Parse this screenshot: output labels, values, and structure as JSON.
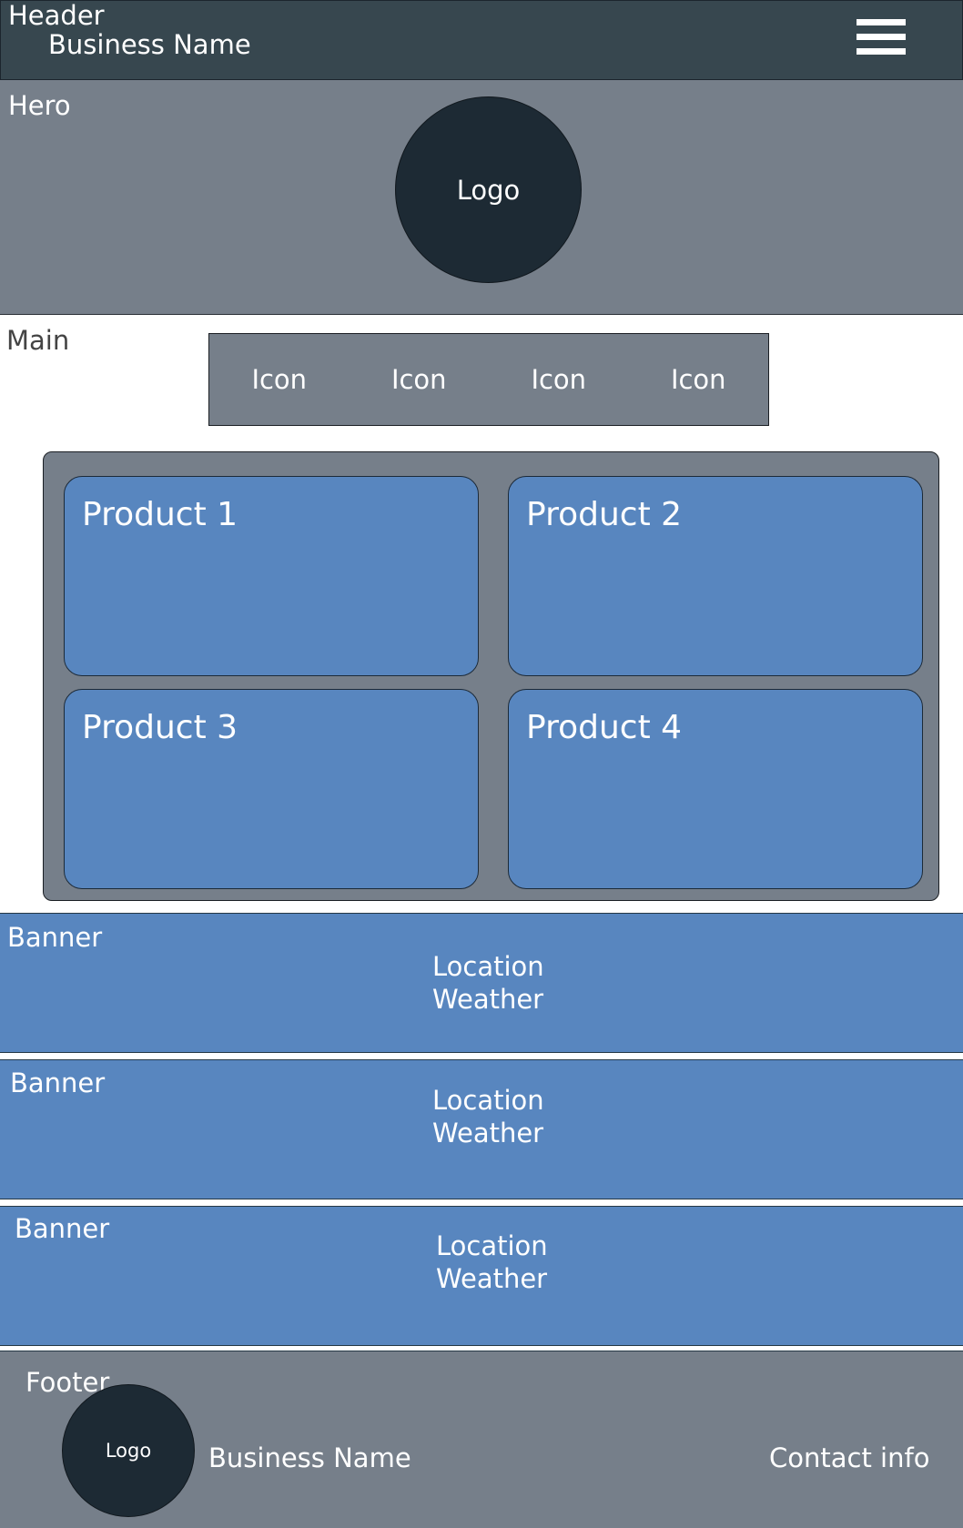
{
  "header": {
    "label": "Header",
    "business_name": "Business Name",
    "menu_icon": "hamburger-menu-icon"
  },
  "hero": {
    "label": "Hero",
    "logo": "Logo"
  },
  "main": {
    "label": "Main",
    "icons": [
      {
        "label": "Icon"
      },
      {
        "label": "Icon"
      },
      {
        "label": "Icon"
      },
      {
        "label": "Icon"
      }
    ],
    "products": [
      {
        "label": "Product 1"
      },
      {
        "label": "Product 2"
      },
      {
        "label": "Product 3"
      },
      {
        "label": "Product 4"
      }
    ]
  },
  "banners": [
    {
      "label": "Banner",
      "location": "Location",
      "weather": "Weather"
    },
    {
      "label": "Banner",
      "location": "Location",
      "weather": "Weather"
    },
    {
      "label": "Banner",
      "location": "Location",
      "weather": "Weather"
    }
  ],
  "footer": {
    "label": "Footer",
    "logo": "Logo",
    "business_name": "Business Name",
    "contact": "Contact info"
  },
  "colors": {
    "header": "#37474f",
    "hero": "#767f8a",
    "banner": "#5886bf",
    "product": "#5886bf",
    "footer": "#767f8a",
    "logo": "#1d2a34"
  }
}
